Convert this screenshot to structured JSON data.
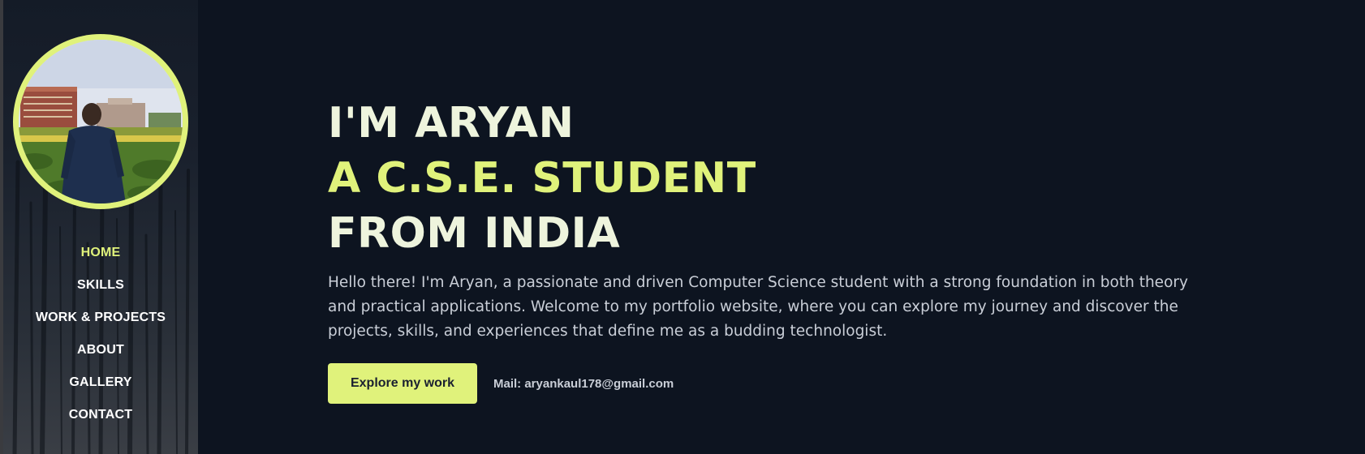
{
  "sidebar": {
    "avatar_alt": "Aryan standing in front of a campus building",
    "nav": [
      {
        "label": "HOME",
        "active": true
      },
      {
        "label": "SKILLS",
        "active": false
      },
      {
        "label": "WORK & PROJECTS",
        "active": false
      },
      {
        "label": "ABOUT",
        "active": false
      },
      {
        "label": "GALLERY",
        "active": false
      },
      {
        "label": "CONTACT",
        "active": false
      }
    ]
  },
  "hero": {
    "line1": "I'M ARYAN",
    "line2": "A C.S.E. STUDENT",
    "line3": "FROM INDIA",
    "intro": "Hello there! I'm Aryan, a passionate and driven Computer Science student with a strong foundation in both theory and practical applications. Welcome to my portfolio website, where you can explore my journey and discover the projects, skills, and experiences that define me as a budding technologist.",
    "cta_label": "Explore my work",
    "mail": "Mail: aryankaul178@gmail.com"
  },
  "colors": {
    "background": "#0d1420",
    "accent": "#e0f27b",
    "text": "#eef4dd",
    "muted": "#c9ced7"
  }
}
